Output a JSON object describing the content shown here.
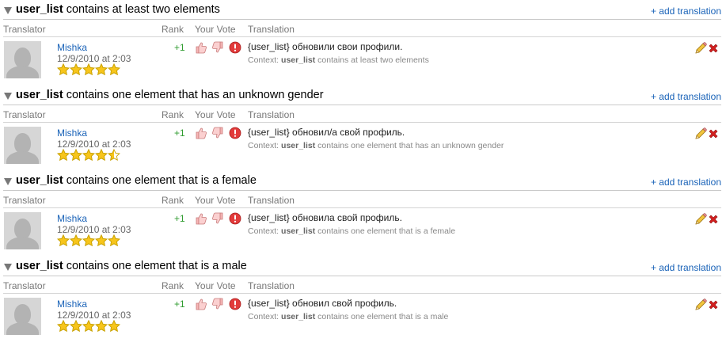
{
  "columns": {
    "translator": "Translator",
    "rank": "Rank",
    "your_vote": "Your Vote",
    "translation": "Translation"
  },
  "add_translation_label": "+ add translation",
  "context_prefix": "Context:",
  "key_name": "user_list",
  "sections": [
    {
      "title_rest": "contains at least two elements",
      "translator": "Mishka",
      "date": "12/9/2010 at 2:03",
      "rating": 5,
      "rank": "+1",
      "translation": "{user_list} обновили свои профили.",
      "context_rest": "contains at least two elements"
    },
    {
      "title_rest": "contains one element that has an unknown gender",
      "translator": "Mishka",
      "date": "12/9/2010 at 2:03",
      "rating": 4.5,
      "rank": "+1",
      "translation": "{user_list} обновил/а свой профиль.",
      "context_rest": "contains one element that has an unknown gender"
    },
    {
      "title_rest": "contains one element that is a female",
      "translator": "Mishka",
      "date": "12/9/2010 at 2:03",
      "rating": 5,
      "rank": "+1",
      "translation": "{user_list} обновила свой профиль.",
      "context_rest": "contains one element that is a female"
    },
    {
      "title_rest": "contains one element that is a male",
      "translator": "Mishka",
      "date": "12/9/2010 at 2:03",
      "rating": 5,
      "rank": "+1",
      "translation": "{user_list} обновил свой профиль.",
      "context_rest": "contains one element that is a male"
    }
  ],
  "colors": {
    "link": "#1a63b8",
    "rank_positive": "#2e9b2e",
    "star_fill": "#f7c51b",
    "delete_red": "#d42020"
  },
  "icons": [
    "collapse-triangle-icon",
    "avatar-placeholder-icon",
    "star-icon",
    "thumbs-up-icon",
    "thumbs-down-icon",
    "report-icon",
    "pencil-icon",
    "delete-x-icon"
  ]
}
